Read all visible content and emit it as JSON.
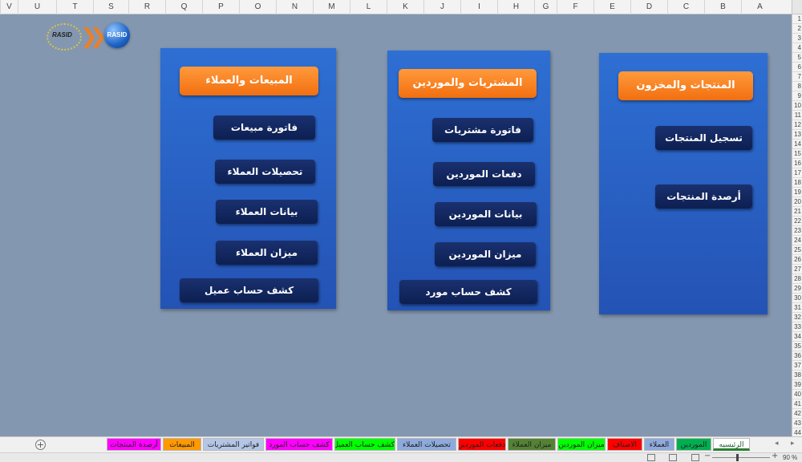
{
  "columns": [
    "V",
    "U",
    "T",
    "S",
    "R",
    "Q",
    "P",
    "O",
    "N",
    "M",
    "L",
    "K",
    "J",
    "I",
    "H",
    "G",
    "F",
    "E",
    "D",
    "C",
    "B",
    "A"
  ],
  "rows": [
    "1",
    "2",
    "3",
    "4",
    "5",
    "6",
    "7",
    "8",
    "9",
    "10",
    "11",
    "12",
    "13",
    "14",
    "15",
    "16",
    "17",
    "18",
    "19",
    "20",
    "21",
    "22",
    "23",
    "24",
    "25",
    "26",
    "27",
    "28",
    "29",
    "30",
    "31",
    "32",
    "33",
    "34",
    "35",
    "36",
    "37",
    "38",
    "39",
    "40",
    "41",
    "42",
    "43",
    "44"
  ],
  "logo": {
    "ring_text": "RASID",
    "ball_text": "RASID"
  },
  "panels": {
    "products": {
      "title": "المنتجات والمخزون",
      "buttons": [
        "تسجيل المنتجات",
        "أرصدة المنتجات"
      ]
    },
    "purchases": {
      "title": "المشتريات والموردين",
      "buttons": [
        "فاتورة مشتريات",
        "دفعات الموردين",
        "بيانات الموردين",
        "ميزان الموردين",
        "كشف حساب مورد"
      ]
    },
    "sales": {
      "title": "المبيعات والعملاء",
      "buttons": [
        "فاتورة مبيعات",
        "تحصيلات العملاء",
        "بيانات العملاء",
        "ميزان العملاء",
        "كشف حساب عميل"
      ]
    }
  },
  "sheet_tabs": [
    {
      "label": "الرئيسيه",
      "color": "#dde9f5",
      "active": true
    },
    {
      "label": "الموردين",
      "color": "#00b050"
    },
    {
      "label": "العملاء",
      "color": "#8ea9db"
    },
    {
      "label": "الاصناف",
      "color": "#ff0000"
    },
    {
      "label": "ميزان الموردين",
      "color": "#00ff00"
    },
    {
      "label": "ميزان العملاء",
      "color": "#548235"
    },
    {
      "label": "دفعات الموردين",
      "color": "#ff0000"
    },
    {
      "label": "تحصيلات العملاء",
      "color": "#8ea9db"
    },
    {
      "label": "كشف حساب العميل",
      "color": "#00ff00"
    },
    {
      "label": "كشف حساب المورد",
      "color": "#ff00ff"
    },
    {
      "label": "فواتير المشتريات",
      "color": "#b4c6e7"
    },
    {
      "label": "المبيعات",
      "color": "#ff9900"
    },
    {
      "label": "أرصدة المنتجات",
      "color": "#ff00ff"
    }
  ],
  "add_sheet_symbol": "+",
  "zoom": {
    "minus": "−",
    "plus": "+",
    "level": "90 %"
  }
}
